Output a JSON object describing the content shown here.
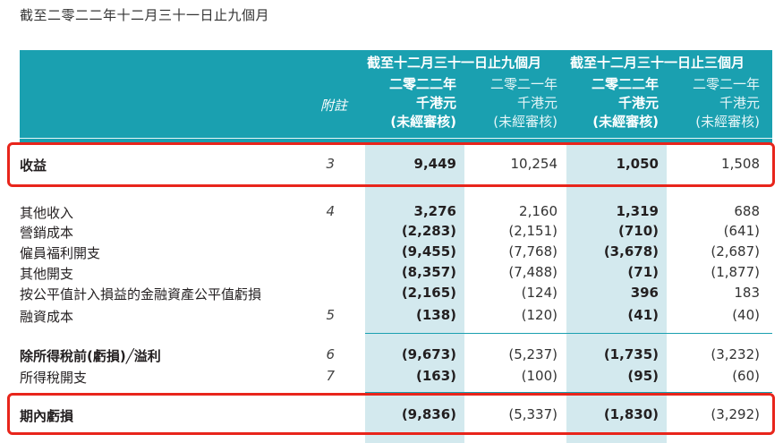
{
  "title": "截至二零二二年十二月三十一日止九個月",
  "header": {
    "note_label": "附註",
    "period_nine": "截至十二月三十一日止九個月",
    "period_three": "截至十二月三十一日止三個月",
    "columns": [
      {
        "year": "二零二二年",
        "unit": "千港元",
        "audit": "(未經審核)"
      },
      {
        "year": "二零二一年",
        "unit": "千港元",
        "audit": "(未經審核)"
      },
      {
        "year": "二零二二年",
        "unit": "千港元",
        "audit": "(未經審核)"
      },
      {
        "year": "二零二一年",
        "unit": "千港元",
        "audit": "(未經審核)"
      }
    ]
  },
  "rows": {
    "revenue": {
      "label": "收益",
      "note": "3",
      "v": [
        "9,449",
        "10,254",
        "1,050",
        "1,508"
      ]
    },
    "other_income": {
      "label": "其他收入",
      "note": "4",
      "v": [
        "3,276",
        "2,160",
        "1,319",
        "688"
      ]
    },
    "marketing": {
      "label": "營銷成本",
      "note": "",
      "v": [
        "(2,283)",
        "(2,151)",
        "(710)",
        "(641)"
      ]
    },
    "staff": {
      "label": "僱員福利開支",
      "note": "",
      "v": [
        "(9,455)",
        "(7,768)",
        "(3,678)",
        "(2,687)"
      ]
    },
    "other_exp": {
      "label": "其他開支",
      "note": "",
      "v": [
        "(8,357)",
        "(7,488)",
        "(71)",
        "(1,877)"
      ]
    },
    "fv_loss": {
      "label": "按公平值計入損益的金融資產公平值虧損",
      "note": "",
      "v": [
        "(2,165)",
        "(124)",
        "396",
        "183"
      ]
    },
    "finance": {
      "label": "融資成本",
      "note": "5",
      "v": [
        "(138)",
        "(120)",
        "(41)",
        "(40)"
      ]
    },
    "pretax": {
      "label": "除所得稅前(虧損)╱溢利",
      "note": "6",
      "v": [
        "(9,673)",
        "(5,237)",
        "(1,735)",
        "(3,232)"
      ]
    },
    "tax": {
      "label": "所得稅開支",
      "note": "7",
      "v": [
        "(163)",
        "(100)",
        "(95)",
        "(60)"
      ]
    },
    "loss": {
      "label": "期內虧損",
      "note": "",
      "v": [
        "(9,836)",
        "(5,337)",
        "(1,830)",
        "(3,292)"
      ]
    }
  },
  "colors": {
    "header_teal": "#1aa0b0",
    "column_shade": "#d3e9ee",
    "highlight_red": "#e8251b"
  }
}
